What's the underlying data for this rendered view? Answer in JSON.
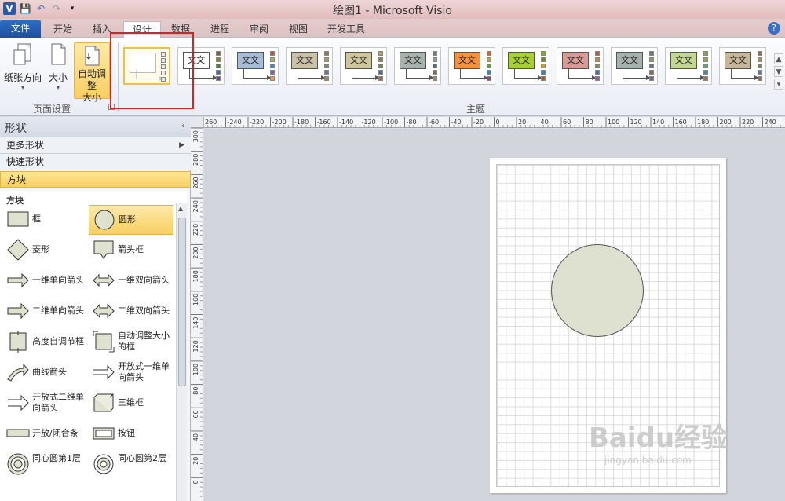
{
  "window": {
    "title": "绘图1 - Microsoft Visio",
    "app_logo": "V",
    "qat": [
      "save-icon",
      "undo-icon",
      "redo-icon",
      "customize-qat-icon"
    ]
  },
  "tabs": [
    {
      "label": "文件",
      "kind": "file"
    },
    {
      "label": "开始"
    },
    {
      "label": "插入"
    },
    {
      "label": "设计",
      "active": true
    },
    {
      "label": "数据"
    },
    {
      "label": "进程"
    },
    {
      "label": "审阅"
    },
    {
      "label": "视图"
    },
    {
      "label": "开发工具"
    }
  ],
  "help_icon": "?",
  "ribbon": {
    "page_setup": {
      "group_label": "页面设置",
      "orientation": "纸张方向",
      "size": "大小",
      "autosize_line1": "自动调整",
      "autosize_line2": "大小"
    },
    "themes": {
      "group_label": "主题",
      "colors": [
        {
          "box": "#ffffff",
          "sw": [
            "#e8e8e8",
            "#e8e8e8",
            "#e8e8e8",
            "#e8e8e8",
            "#e8e8e8"
          ]
        },
        {
          "box": "#ffffff",
          "sw": [
            "#7a5c4a",
            "#8b7f3a",
            "#5a7a3a",
            "#4a6a8a",
            "#5a4a8a"
          ]
        },
        {
          "box": "#a7bcd6",
          "sw": [
            "#c0504d",
            "#9bbb59",
            "#4f81bd",
            "#8064a2",
            "#f79646"
          ]
        },
        {
          "box": "#c9c2a7",
          "sw": [
            "#8a7a5a",
            "#a69c6a",
            "#7a8a6a",
            "#6a7a8a",
            "#9a8a6a"
          ]
        },
        {
          "box": "#cfc69d",
          "sw": [
            "#b0a36a",
            "#8c7c4c",
            "#6a8a4a",
            "#4a6a9a",
            "#a06a4a"
          ]
        },
        {
          "box": "#a9b3ad",
          "sw": [
            "#6a7a7a",
            "#8a9a8a",
            "#5a6a7a",
            "#7a6a5a",
            "#9a8a7a"
          ]
        },
        {
          "box": "#f5913b",
          "sw": [
            "#e06020",
            "#c0a030",
            "#60a040",
            "#4080c0",
            "#a04080"
          ]
        },
        {
          "box": "#a8d030",
          "sw": [
            "#80b020",
            "#609020",
            "#c0a030",
            "#4080a0",
            "#a06030"
          ]
        },
        {
          "box": "#d89a94",
          "sw": [
            "#b05a50",
            "#c08a50",
            "#809050",
            "#5070a0",
            "#906090"
          ]
        },
        {
          "box": "#a6b2ae",
          "sw": [
            "#6a7a76",
            "#8a9a6a",
            "#5a7a9a",
            "#8a6a5a",
            "#7a6a8a"
          ]
        },
        {
          "box": "#c2d890",
          "sw": [
            "#8aa050",
            "#a0a050",
            "#60a080",
            "#5080a0",
            "#a07050"
          ]
        },
        {
          "box": "#c8b69a",
          "sw": [
            "#8a7050",
            "#a09060",
            "#708a60",
            "#607a9a",
            "#9a6a5a"
          ]
        }
      ],
      "box_label": "文文"
    }
  },
  "shapes_pane": {
    "title": "形状",
    "collapse_icon": "‹",
    "more_shapes": "更多形状",
    "quick_shapes": "快速形状",
    "current_stencil": "方块",
    "stencil_title": "方块",
    "items": [
      {
        "label": "框",
        "icon": "rect-icon"
      },
      {
        "label": "圆形",
        "icon": "circle-icon",
        "selected": true
      },
      {
        "label": "菱形",
        "icon": "diamond-icon"
      },
      {
        "label": "箭头框",
        "icon": "callout-box-icon"
      },
      {
        "label": "一维单向箭头",
        "icon": "arrow-right-icon"
      },
      {
        "label": "一维双向箭头",
        "icon": "arrow-double-icon"
      },
      {
        "label": "二维单向箭头",
        "icon": "arrow2d-right-icon"
      },
      {
        "label": "二维双向箭头",
        "icon": "arrow2d-double-icon"
      },
      {
        "label": "高度自调节框",
        "icon": "auto-height-box-icon"
      },
      {
        "label": "自动调整大小的框",
        "icon": "auto-size-box-icon",
        "two_line": true
      },
      {
        "label": "曲线箭头",
        "icon": "curved-arrow-icon"
      },
      {
        "label": "开放式一维单向箭头",
        "icon": "open-arrow1d-icon",
        "two_line": true
      },
      {
        "label": "开放式二维单向箭头",
        "icon": "open-arrow2d-icon",
        "two_line": true
      },
      {
        "label": "三维框",
        "icon": "box3d-icon"
      },
      {
        "label": "开放/闭合条",
        "icon": "bar-icon"
      },
      {
        "label": "按钮",
        "icon": "button-shape-icon"
      },
      {
        "label": "同心圆第1层",
        "icon": "concentric1-icon",
        "two_line": true
      },
      {
        "label": "同心圆第2层",
        "icon": "concentric2-icon",
        "two_line": true
      }
    ]
  },
  "ruler": {
    "h_ticks": [
      "260",
      "-240",
      "-220",
      "-200",
      "-180",
      "-160",
      "-140",
      "-120",
      "-100",
      "-80",
      "-60",
      "-40",
      "-20",
      "0",
      "20",
      "40",
      "60",
      "80",
      "100",
      "120",
      "140",
      "160",
      "180",
      "200",
      "220",
      "240"
    ],
    "v_ticks": [
      "300",
      "280",
      "260",
      "240",
      "220",
      "200",
      "180",
      "160",
      "140",
      "120",
      "100",
      "80",
      "60",
      "40",
      "20",
      "0"
    ]
  },
  "watermark": {
    "brand": "Baidu经验",
    "url": "jingyan.baidu.com"
  }
}
